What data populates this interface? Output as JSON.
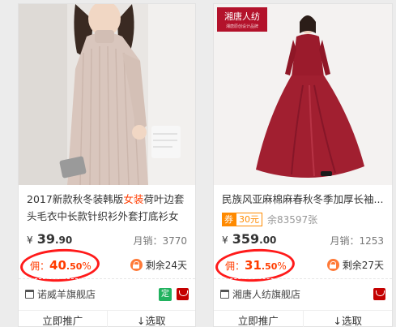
{
  "cards": [
    {
      "title_before": "2017新款秋冬装韩版",
      "title_highlight": "女装",
      "title_after": "荷叶边套头毛衣中长款针织衫外套打底衫女",
      "coupon": null,
      "price_currency": "¥",
      "price_int": "39",
      "price_dec": ".90",
      "sales": "月销：3770",
      "commission_label": "佣：",
      "commission_int": "40",
      "commission_dec": ".50",
      "commission_pct": "%",
      "remaining": "剩余24天",
      "shop": "诺威羊旗舰店",
      "badge": "定",
      "btn_promote": "立即推广",
      "btn_select": "↓选取",
      "colors": {
        "highlight": "#ff3c00",
        "badge": "#21b25f",
        "tmall": "#c40000",
        "circle": "#ff1a1a"
      },
      "icons": [
        "lock-icon",
        "store-icon",
        "tmall-icon"
      ]
    },
    {
      "brand_logo": "湘唐人纺",
      "brand_tagline": "湘唐原创设计品牌",
      "title_before": "民族风亚麻棉麻春秋冬季加厚长袖...",
      "coupon_tag": "券",
      "coupon_amount": "30元",
      "coupon_left": "余83597张",
      "price_currency": "¥",
      "price_int": "359",
      "price_dec": ".00",
      "sales": "月销：1253",
      "commission_label": "佣：",
      "commission_int": "31",
      "commission_dec": ".50",
      "commission_pct": "%",
      "remaining": "剩余27天",
      "shop": "湘唐人纺旗舰店",
      "btn_promote": "立即推广",
      "btn_select": "↓选取",
      "colors": {
        "coupon": "#ff8a00",
        "tmall": "#c40000",
        "circle": "#ff1a1a",
        "dress": "#9b1b2c"
      },
      "icons": [
        "lock-icon",
        "store-icon",
        "tmall-icon"
      ]
    }
  ]
}
